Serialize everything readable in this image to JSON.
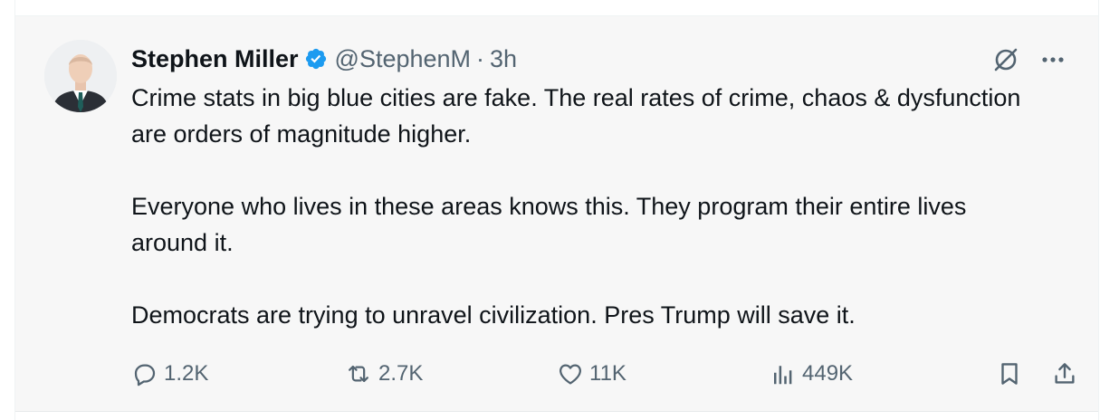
{
  "author": {
    "name": "Stephen Miller",
    "handle": "@StephenM",
    "separator": "·",
    "time": "3h",
    "avatar_icon": "profile-photo"
  },
  "tweet": {
    "paragraphs": [
      "Crime stats in big blue cities are fake. The real rates of crime, chaos & dysfunction are orders of magnitude higher.",
      "Everyone who lives in these areas knows this. They program their entire lives around it.",
      "Democrats are trying to unravel civilization. Pres Trump will save it."
    ]
  },
  "actions": {
    "replies": "1.2K",
    "reposts": "2.7K",
    "likes": "11K",
    "views": "449K"
  },
  "colors": {
    "verified": "#1d9bf0",
    "text": "#0f1419",
    "muted": "#536471",
    "card_bg": "#f7f7f7"
  }
}
